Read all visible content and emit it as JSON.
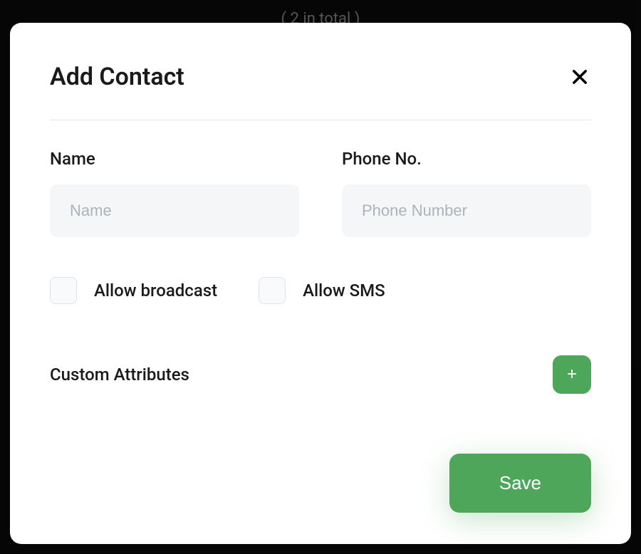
{
  "backdrop": {
    "top_text": "( 2 in total )"
  },
  "modal": {
    "title": "Add Contact",
    "fields": {
      "name": {
        "label": "Name",
        "placeholder": "Name",
        "value": ""
      },
      "phone": {
        "label": "Phone No.",
        "placeholder": "Phone Number",
        "value": ""
      }
    },
    "checkboxes": {
      "broadcast": {
        "label": "Allow broadcast",
        "checked": false
      },
      "sms": {
        "label": "Allow SMS",
        "checked": false
      }
    },
    "custom_attributes": {
      "label": "Custom Attributes"
    },
    "actions": {
      "save_label": "Save"
    }
  }
}
